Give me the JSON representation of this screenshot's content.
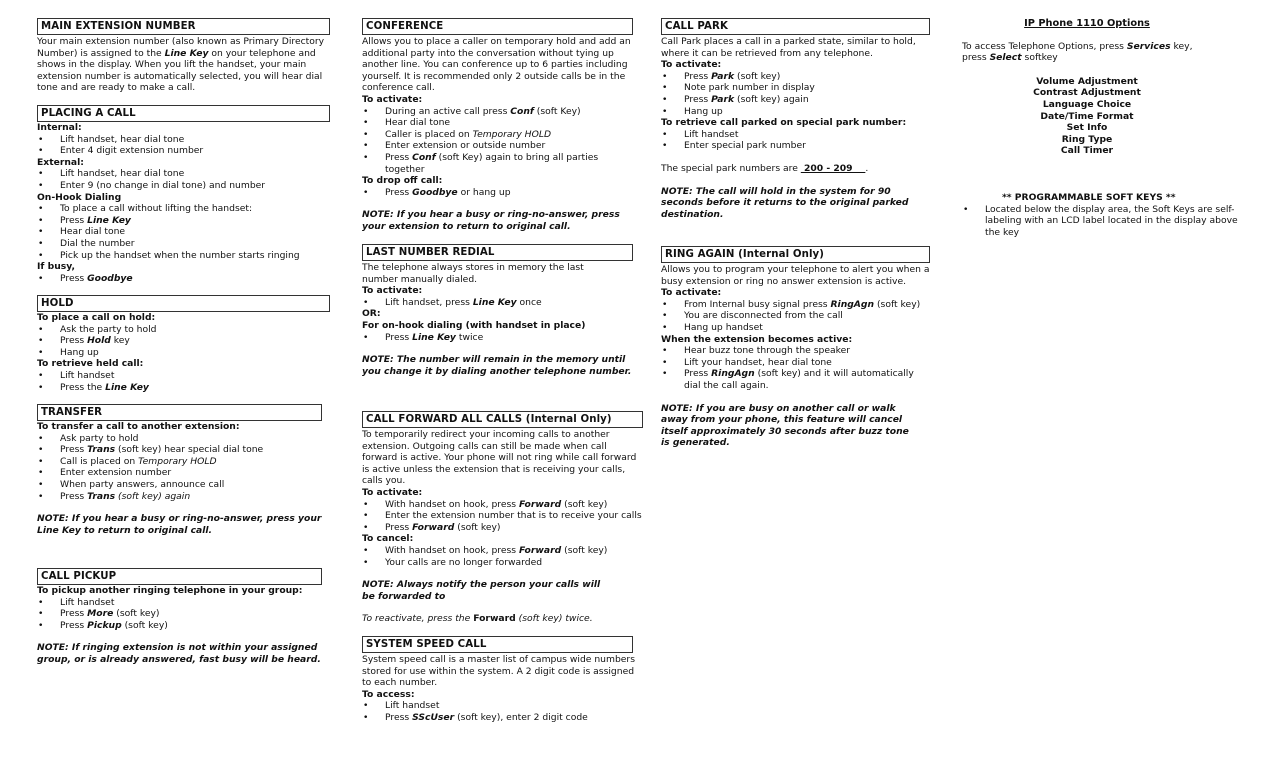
{
  "col1": {
    "main_ext": {
      "title": "MAIN EXTENSION NUMBER",
      "body": [
        "Your main extension number (also known as Primary Directory Number) is assigned to the ",
        "Line Key",
        " on your telephone and shows in the display.  When you lift the handset, your main extension number is automatically selected, you will hear dial tone and are ready to make a call."
      ]
    },
    "placing": {
      "title": "PLACING A CALL",
      "internal": "Internal:",
      "internal_items": [
        "Lift handset, hear dial tone",
        "Enter 4 digit extension number"
      ],
      "external": "External:",
      "external_items": [
        "Lift handset, hear dial tone",
        "Enter 9 (no change in dial tone) and number"
      ],
      "onhook": "On-Hook Dialing",
      "onhook_items": [
        "To place a call without lifting the handset:",
        "Press ",
        "Line Key",
        "Hear dial tone",
        "Dial the number",
        "Pick up the handset when the number starts ringing"
      ],
      "busy": "If busy,",
      "busy_item": [
        "Press ",
        "Goodbye"
      ]
    },
    "hold": {
      "title": "HOLD",
      "place": "To place a call on hold:",
      "place_items": [
        "Ask the party to hold",
        "Press ",
        "Hold",
        " key",
        "Hang up"
      ],
      "retrieve": "To retrieve held call:",
      "retrieve_items": [
        "Lift handset",
        "Press the ",
        "Line Key"
      ]
    },
    "transfer": {
      "title": "TRANSFER",
      "sub": "To transfer a call to another extension:",
      "items": [
        "Ask party to hold",
        "Press ",
        "Trans",
        " (soft key) hear special dial tone",
        "Call is placed on ",
        "Temporary HOLD",
        "Enter extension number",
        "When party answers, announce call",
        "Press ",
        "Trans",
        " (soft key) again"
      ],
      "note": "NOTE:  If you hear a busy or ring-no-answer, press your Line Key to return to original call."
    },
    "pickup": {
      "title": "CALL PICKUP",
      "sub": "To pickup another ringing telephone in your group:",
      "items": [
        "Lift handset",
        "Press ",
        "More",
        " (soft key)",
        "Press ",
        "Pickup",
        " (soft key)"
      ],
      "note": "NOTE:  If ringing extension is not within your assigned group, or is already answered, fast busy will be heard."
    }
  },
  "col2": {
    "conference": {
      "title": "CONFERENCE",
      "body": "Allows you to place a caller on temporary hold and add an additional party into the conversation without tying up another line.  You can conference up to 6 parties including yourself. It is recommended only 2 outside calls be in the conference call.",
      "activate": "To activate:",
      "items": [
        "During an active call press ",
        "Conf",
        " (soft Key)",
        "Hear dial tone",
        "Caller is placed on ",
        "Temporary HOLD",
        "Enter extension or outside number",
        "Press ",
        "Conf",
        " (soft Key) again to bring all parties together"
      ],
      "drop": "To drop off call:",
      "drop_item": [
        "Press ",
        "Goodbye",
        " or hang up"
      ],
      "note": "NOTE:  If you hear a busy or ring-no-answer, press your extension to return to original call."
    },
    "redial": {
      "title": "LAST NUMBER REDIAL",
      "body": "The telephone always stores in memory the last number manually dialed.",
      "activate": "To activate:",
      "item1": [
        "Lift handset, press ",
        "Line Key",
        " once"
      ],
      "or": "OR:",
      "onhook": "For on-hook dialing (with handset in place)",
      "item2": [
        "Press ",
        "Line Key",
        " twice"
      ],
      "note": "NOTE:  The number will remain in the memory until you change it by dialing another telephone number."
    },
    "forward": {
      "title": "CALL FORWARD ALL CALLS (Internal Only)",
      "body": "To temporarily redirect your incoming calls to another extension. Outgoing calls can still be made when call forward is active.  Your phone will not ring while call forward is active unless the extension that is receiving your calls, calls you.",
      "activate": "To activate:",
      "items": [
        "With handset on hook, press ",
        "Forward",
        " (soft key)",
        "Enter the extension number that is to receive your calls",
        "Press ",
        "Forward",
        " (soft key)"
      ],
      "cancel": "To cancel:",
      "cancel_items": [
        "With handset on hook, press ",
        "Forward",
        " (soft key)",
        "Your calls are no longer forwarded"
      ],
      "note": "NOTE:  Always notify the person your calls will be forwarded to",
      "reactivate": [
        "To reactivate, press the ",
        "Forward",
        " (soft key) twice."
      ]
    },
    "speed": {
      "title": "SYSTEM SPEED CALL",
      "body": "System speed call is a master list of campus  wide numbers stored for use within the system.  A 2 digit code is assigned to each number.",
      "access": "To access:",
      "items": [
        "Lift handset",
        "Press ",
        "SScUser",
        " (soft key), enter 2 digit code"
      ]
    }
  },
  "col3": {
    "park": {
      "title": "CALL PARK",
      "body": "Call Park places a call in a parked state, similar to hold, where it can be retrieved from any telephone.",
      "activate": "To activate:",
      "items": [
        "Press ",
        "Park",
        " (soft key)",
        "Note park number in display",
        "Press ",
        "Park",
        " (soft key) again",
        "Hang up"
      ],
      "retrieve": "To retrieve call parked on special park number:",
      "retrieve_items": [
        "Lift handset",
        "Enter special park number"
      ],
      "special_prefix": "The special park numbers are ",
      "special_value": " 200 - 209    ",
      "special_suffix": ".",
      "note": "NOTE:  The call will hold in the system for 90 seconds before it returns to the original parked destination."
    },
    "ringagain": {
      "title": "RING AGAIN (Internal Only)",
      "body": "Allows you to program your telephone to alert you when a busy extension or ring no answer extension is active.",
      "activate": "To activate:",
      "items": [
        "From Internal busy signal press ",
        "RingAgn",
        " (soft key)",
        "You are disconnected from the call",
        "Hang up handset"
      ],
      "active": "When the extension becomes active:",
      "active_items": [
        "Hear buzz tone through the speaker",
        "Lift your handset, hear dial tone",
        "Press ",
        "RingAgn",
        " (soft key) and it will automatically dial the call again."
      ],
      "note": "NOTE:  If you are busy on another call or walk away from your phone, this feature will cancel itself approximately 30 seconds after buzz tone is generated."
    }
  },
  "col4": {
    "title": "IP Phone 1110 Options",
    "intro": [
      "To access Telephone Options, press ",
      "Services",
      " key, press ",
      "Select",
      " softkey"
    ],
    "options": [
      "Volume Adjustment",
      "Contrast Adjustment",
      "Language Choice",
      "Date/Time Format",
      "Set Info",
      "Ring Type",
      "Call Timer"
    ],
    "softkeys_title": "** PROGRAMMABLE SOFT KEYS **",
    "softkeys_item": "Located below the display area, the Soft Keys are self-labeling with an LCD label located in the display above the key"
  }
}
